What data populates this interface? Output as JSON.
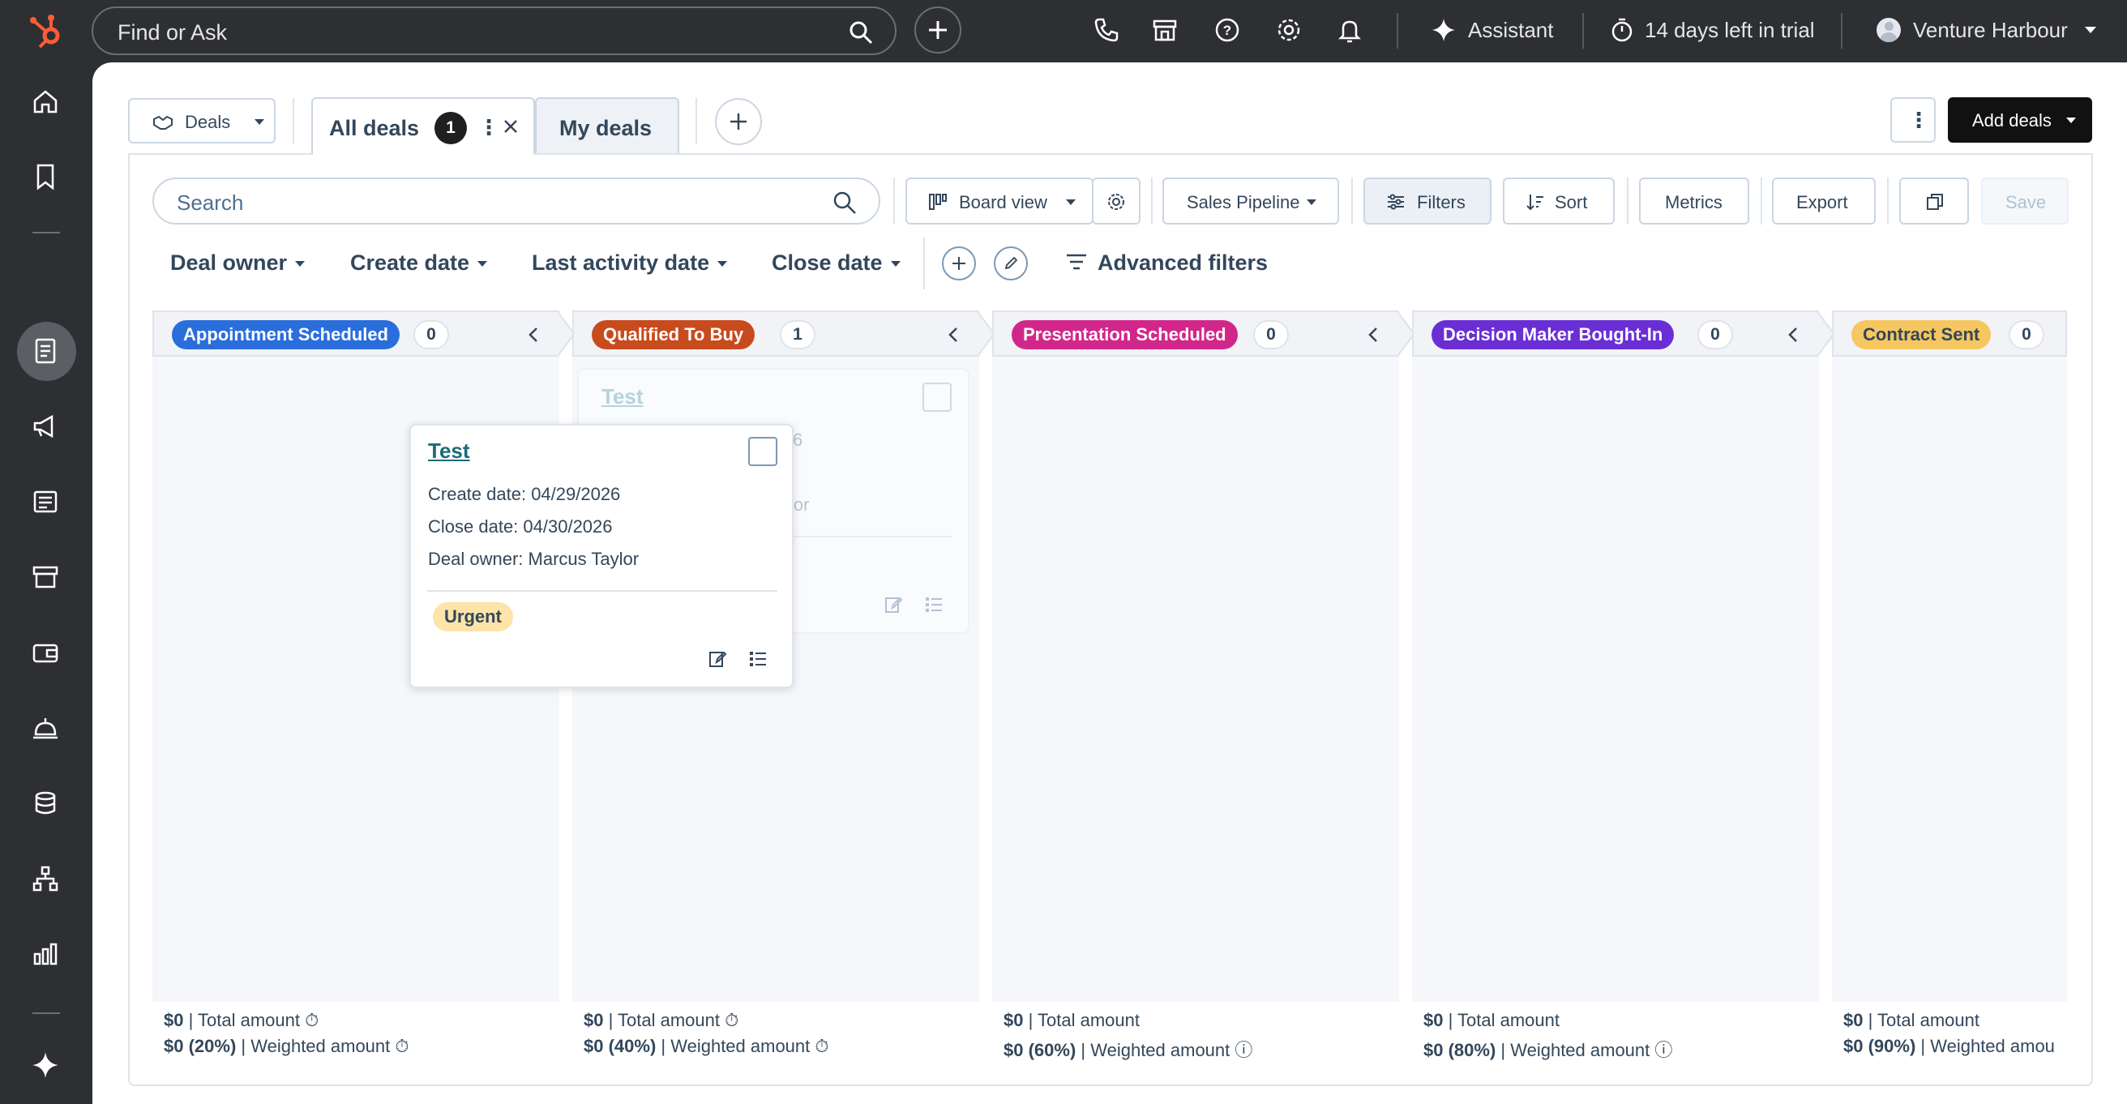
{
  "topbar": {
    "search_placeholder": "Find or Ask",
    "assistant_label": "Assistant",
    "trial_label": "14 days left in trial",
    "account_name": "Venture Harbour"
  },
  "object_selector": {
    "label": "Deals"
  },
  "tabs": [
    {
      "label": "All deals",
      "count": "1"
    },
    {
      "label": "My deals"
    }
  ],
  "actions": {
    "add_deals_label": "Add deals"
  },
  "toolbar": {
    "search_placeholder": "Search",
    "view_label": "Board view",
    "pipeline_label": "Sales Pipeline",
    "filters_label": "Filters",
    "sort_label": "Sort",
    "metrics_label": "Metrics",
    "export_label": "Export",
    "save_label": "Save"
  },
  "filters": {
    "deal_owner": "Deal owner",
    "create_date": "Create date",
    "last_activity_date": "Last activity date",
    "close_date": "Close date",
    "advanced": "Advanced filters"
  },
  "columns": [
    {
      "stage": "Appointment Scheduled",
      "count": "0",
      "color": "#2a6edb",
      "text_color": "#ffffff",
      "total": "$0",
      "total_label": "| Total amount",
      "weighted": "$0 (20%)",
      "weighted_label": "| Weighted amount"
    },
    {
      "stage": "Qualified To Buy",
      "count": "1",
      "color": "#c84b1e",
      "text_color": "#ffffff",
      "total": "$0",
      "total_label": "| Total amount",
      "weighted": "$0 (40%)",
      "weighted_label": "| Weighted amount"
    },
    {
      "stage": "Presentation Scheduled",
      "count": "0",
      "color": "#d2278a",
      "text_color": "#ffffff",
      "total": "$0",
      "total_label": "| Total amount",
      "weighted": "$0 (60%)",
      "weighted_label": "| Weighted amount"
    },
    {
      "stage": "Decision Maker Bought-In",
      "count": "0",
      "color": "#6a2fd4",
      "text_color": "#ffffff",
      "total": "$0",
      "total_label": "| Total amount",
      "weighted": "$0 (80%)",
      "weighted_label": "| Weighted amount"
    },
    {
      "stage": "Contract Sent",
      "count": "0",
      "color": "#f6c760",
      "text_color": "#33475b",
      "total": "$0",
      "total_label": "| Total amount",
      "weighted": "$0 (90%)",
      "weighted_label": "| Weighted amou"
    }
  ],
  "card_placeholder": {
    "title": "Test",
    "fragment1": "6",
    "fragment2": "lor"
  },
  "card_dragging": {
    "title": "Test",
    "create_date": "Create date: 04/29/2026",
    "close_date": "Close date: 04/30/2026",
    "owner": "Deal owner: Marcus Taylor",
    "tag": "Urgent"
  }
}
